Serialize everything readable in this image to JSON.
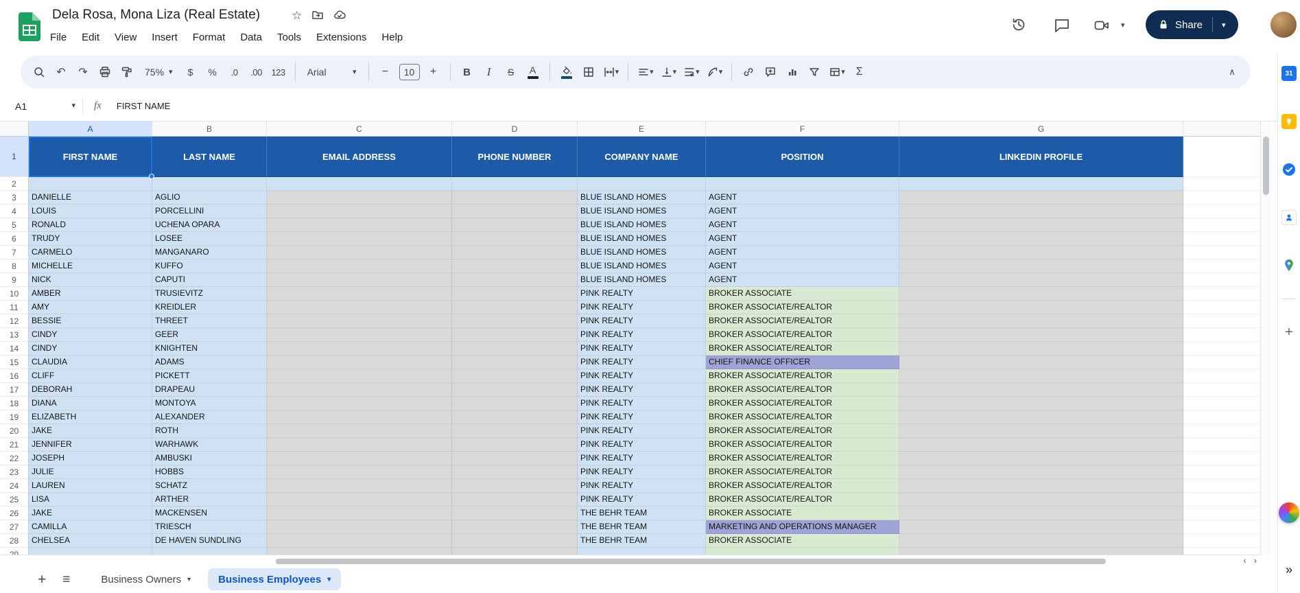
{
  "titlebar": {
    "title": "Dela Rosa, Mona Liza (Real Estate)",
    "menus": [
      "File",
      "Edit",
      "View",
      "Insert",
      "Format",
      "Data",
      "Tools",
      "Extensions",
      "Help"
    ],
    "share_label": "Share"
  },
  "toolbar": {
    "zoom": "75%",
    "currency": "$",
    "percent": "%",
    "dec_decrease": ".0",
    "dec_increase": ".00",
    "number_format": "123",
    "font_family": "Arial",
    "font_size": "10",
    "bold": "B",
    "italic": "I",
    "strikethrough": "S",
    "text_color": "A"
  },
  "formula_bar": {
    "cell_ref": "A1",
    "fx": "fx",
    "content": "FIRST NAME"
  },
  "sheet": {
    "column_letters": [
      "A",
      "B",
      "C",
      "D",
      "E",
      "F",
      "G"
    ],
    "header_row": [
      "FIRST NAME",
      "LAST NAME",
      "EMAIL ADDRESS",
      "PHONE NUMBER",
      "COMPANY NAME",
      "POSITION",
      "LINKEDIN PROFILE"
    ],
    "rows": [
      {
        "n": "2",
        "variant": "blank"
      },
      {
        "n": "3",
        "variant": "data",
        "first": "DANIELLE",
        "last": "AGLIO",
        "company": "BLUE ISLAND HOMES",
        "position": "AGENT",
        "pos_style": "blue"
      },
      {
        "n": "4",
        "variant": "data",
        "first": "LOUIS",
        "last": "PORCELLINI",
        "company": "BLUE ISLAND HOMES",
        "position": "AGENT",
        "pos_style": "blue"
      },
      {
        "n": "5",
        "variant": "data",
        "first": "RONALD",
        "last": "UCHENA OPARA",
        "company": "BLUE ISLAND HOMES",
        "position": "AGENT",
        "pos_style": "blue"
      },
      {
        "n": "6",
        "variant": "data",
        "first": "TRUDY",
        "last": "LOSEE",
        "company": "BLUE ISLAND HOMES",
        "position": "AGENT",
        "pos_style": "blue"
      },
      {
        "n": "7",
        "variant": "data",
        "first": "CARMELO",
        "last": "MANGANARO",
        "company": "BLUE ISLAND HOMES",
        "position": "AGENT",
        "pos_style": "blue"
      },
      {
        "n": "8",
        "variant": "data",
        "first": "MICHELLE",
        "last": "KUFFO",
        "company": "BLUE ISLAND HOMES",
        "position": "AGENT",
        "pos_style": "blue"
      },
      {
        "n": "9",
        "variant": "data",
        "first": "NICK",
        "last": "CAPUTI",
        "company": "BLUE ISLAND HOMES",
        "position": "AGENT",
        "pos_style": "blue"
      },
      {
        "n": "10",
        "variant": "data",
        "first": "AMBER",
        "last": "TRUSIEVITZ",
        "company": "PINK REALTY",
        "position": "BROKER ASSOCIATE",
        "pos_style": "green"
      },
      {
        "n": "11",
        "variant": "data",
        "first": "AMY",
        "last": "KREIDLER",
        "company": "PINK REALTY",
        "position": "BROKER ASSOCIATE/REALTOR",
        "pos_style": "green"
      },
      {
        "n": "12",
        "variant": "data",
        "first": "BESSIE",
        "last": "THREET",
        "company": "PINK REALTY",
        "position": "BROKER ASSOCIATE/REALTOR",
        "pos_style": "green"
      },
      {
        "n": "13",
        "variant": "data",
        "first": "CINDY",
        "last": "GEER",
        "company": "PINK REALTY",
        "position": "BROKER ASSOCIATE/REALTOR",
        "pos_style": "green"
      },
      {
        "n": "14",
        "variant": "data",
        "first": "CINDY",
        "last": "KNIGHTEN",
        "company": "PINK REALTY",
        "position": "BROKER ASSOCIATE/REALTOR",
        "pos_style": "green"
      },
      {
        "n": "15",
        "variant": "data",
        "first": "CLAUDIA",
        "last": "ADAMS",
        "company": "PINK REALTY",
        "position": "CHIEF FINANCE OFFICER",
        "pos_style": "purple"
      },
      {
        "n": "16",
        "variant": "data",
        "first": "CLIFF",
        "last": "PICKETT",
        "company": "PINK REALTY",
        "position": "BROKER ASSOCIATE/REALTOR",
        "pos_style": "green"
      },
      {
        "n": "17",
        "variant": "data",
        "first": "DEBORAH",
        "last": "DRAPEAU",
        "company": "PINK REALTY",
        "position": "BROKER ASSOCIATE/REALTOR",
        "pos_style": "green"
      },
      {
        "n": "18",
        "variant": "data",
        "first": "DIANA",
        "last": "MONTOYA",
        "company": "PINK REALTY",
        "position": "BROKER ASSOCIATE/REALTOR",
        "pos_style": "green"
      },
      {
        "n": "19",
        "variant": "data",
        "first": "ELIZABETH",
        "last": "ALEXANDER",
        "company": "PINK REALTY",
        "position": "BROKER ASSOCIATE/REALTOR",
        "pos_style": "green"
      },
      {
        "n": "20",
        "variant": "data",
        "first": "JAKE",
        "last": "ROTH",
        "company": "PINK REALTY",
        "position": "BROKER ASSOCIATE/REALTOR",
        "pos_style": "green"
      },
      {
        "n": "21",
        "variant": "data",
        "first": "JENNIFER",
        "last": "WARHAWK",
        "company": "PINK REALTY",
        "position": "BROKER ASSOCIATE/REALTOR",
        "pos_style": "green"
      },
      {
        "n": "22",
        "variant": "data",
        "first": "JOSEPH",
        "last": "AMBUSKI",
        "company": "PINK REALTY",
        "position": "BROKER ASSOCIATE/REALTOR",
        "pos_style": "green"
      },
      {
        "n": "23",
        "variant": "data",
        "first": "JULIE",
        "last": "HOBBS",
        "company": "PINK REALTY",
        "position": "BROKER ASSOCIATE/REALTOR",
        "pos_style": "green"
      },
      {
        "n": "24",
        "variant": "data",
        "first": "LAUREN",
        "last": "SCHATZ",
        "company": "PINK REALTY",
        "position": "BROKER ASSOCIATE/REALTOR",
        "pos_style": "green"
      },
      {
        "n": "25",
        "variant": "data",
        "first": "LISA",
        "last": "ARTHER",
        "company": "PINK REALTY",
        "position": "BROKER ASSOCIATE/REALTOR",
        "pos_style": "green"
      },
      {
        "n": "26",
        "variant": "data",
        "first": "JAKE",
        "last": "MACKENSEN",
        "company": "THE BEHR TEAM",
        "position": "BROKER ASSOCIATE",
        "pos_style": "green"
      },
      {
        "n": "27",
        "variant": "data",
        "first": "CAMILLA",
        "last": "TRIESCH",
        "company": "THE BEHR TEAM",
        "position": "MARKETING AND OPERATIONS MANAGER",
        "pos_style": "purple"
      },
      {
        "n": "28",
        "variant": "data",
        "first": "CHELSEA",
        "last": "DE HAVEN SUNDLING",
        "company": "THE BEHR TEAM",
        "position": "BROKER ASSOCIATE",
        "pos_style": "green"
      },
      {
        "n": "29",
        "variant": "partial",
        "first": "",
        "last": "",
        "company": "",
        "position": "",
        "pos_style": "green"
      }
    ]
  },
  "tabs": {
    "sheet_tabs": [
      {
        "label": "Business Owners",
        "active": false
      },
      {
        "label": "Business Employees",
        "active": true
      }
    ]
  },
  "icons": {
    "caret_down": "▾",
    "undo": "↶",
    "redo": "↷",
    "sigma": "Σ",
    "star": "☆",
    "hamburger": "≡",
    "plus": "+",
    "minus": "−",
    "collapse": "∧",
    "chevrons_right": "»",
    "scroll_left": "‹",
    "scroll_right": "›",
    "calendar_label": "31"
  },
  "colors": {
    "header_bg": "#1d5aa8",
    "light_blue": "#cfe2f3",
    "gray": "#d9d9d9",
    "green": "#d9ead3",
    "purple": "#9fa4d6",
    "accent_blue": "#1a73e8",
    "share_bg": "#0f2d52",
    "fill_indicator": "#0f525c",
    "active_tab_bg": "#dce7f8",
    "tab_active_text": "#0b57d0"
  }
}
